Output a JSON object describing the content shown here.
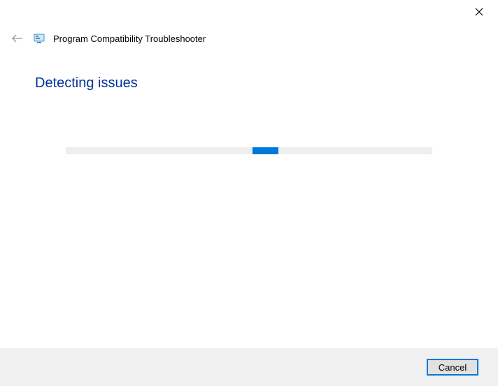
{
  "window": {
    "app_title": "Program Compatibility Troubleshooter"
  },
  "main": {
    "heading": "Detecting issues"
  },
  "footer": {
    "cancel_label": "Cancel"
  }
}
